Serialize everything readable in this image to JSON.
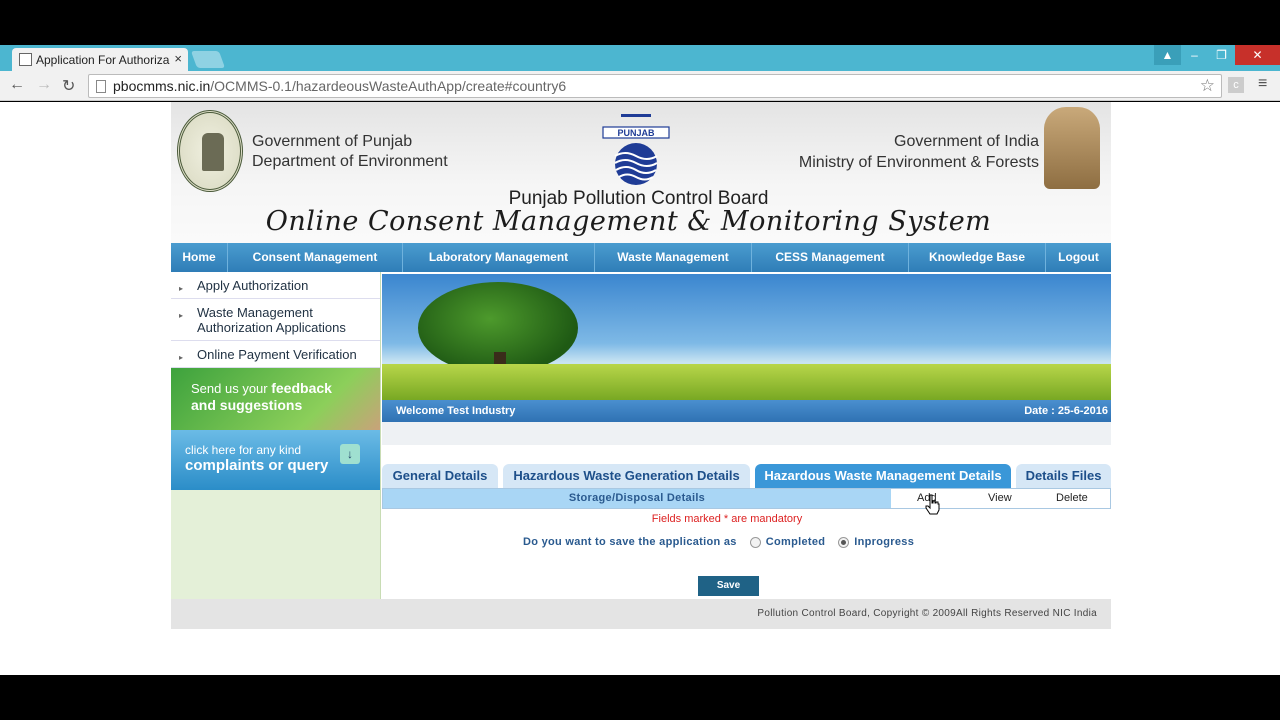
{
  "browser": {
    "tab_title": "Application For Authoriza",
    "tab_close": "×",
    "url_host": "pbocmms.nic.in",
    "url_path": "/OCMMS-0.1/hazardeousWasteAuthApp/create#country6",
    "back_icon": "←",
    "forward_icon": "→",
    "reload_icon": "↻",
    "star_icon": "☆",
    "ext_icon_label": "c",
    "menu_icon": "≡",
    "win_user": "▲",
    "win_min": "–",
    "win_restore": "❐",
    "win_close": "✕"
  },
  "header": {
    "punjab_line1": "Government of Punjab",
    "punjab_line2": "Department of Environment",
    "logo_text": "PUNJAB",
    "india_line1": "Government of India",
    "india_line2": "Ministry of Environment & Forests",
    "board_name": "Punjab Pollution Control Board",
    "system_name": "Online Consent Management & Monitoring System"
  },
  "nav": {
    "items": [
      "Home",
      "Consent Management",
      "Laboratory Management",
      "Waste Management",
      "CESS Management",
      "Knowledge Base",
      "Logout"
    ]
  },
  "sidebar": {
    "links": [
      "Apply Authorization",
      "Waste Management Authorization Applications",
      "Online Payment Verification"
    ],
    "feedback_line1": "Send us your",
    "feedback_bold1": "feedback",
    "feedback_bold2": "and suggestions",
    "complaint_line1": "click here for any kind",
    "complaint_bold": "complaints or query",
    "complaint_arrow": "↓"
  },
  "content": {
    "welcome": "Welcome Test Industry",
    "date": "Date : 25-6-2016",
    "tabs": [
      "General Details",
      "Hazardous Waste Generation Details",
      "Hazardous Waste Management Details",
      "Details Files"
    ],
    "active_tab": 2,
    "subbar_title": "Storage/Disposal Details",
    "action_add": "Add",
    "action_view": "View",
    "action_delete": "Delete",
    "mandatory": "Fields marked * are mandatory",
    "save_as_question": "Do you want to save the application as",
    "option_completed": "Completed",
    "option_inprogress": "Inprogress",
    "selected_option": "Inprogress",
    "save_button": "Save"
  },
  "footer": {
    "copyright": "Pollution Control Board, Copyright © 2009All Rights Reserved NIC India"
  },
  "colors": {
    "chrome_accent": "#4cb6d0",
    "nav_blue": "#2f7db7",
    "active_tab": "#3a97d8",
    "mandatory_red": "#dd2222"
  }
}
